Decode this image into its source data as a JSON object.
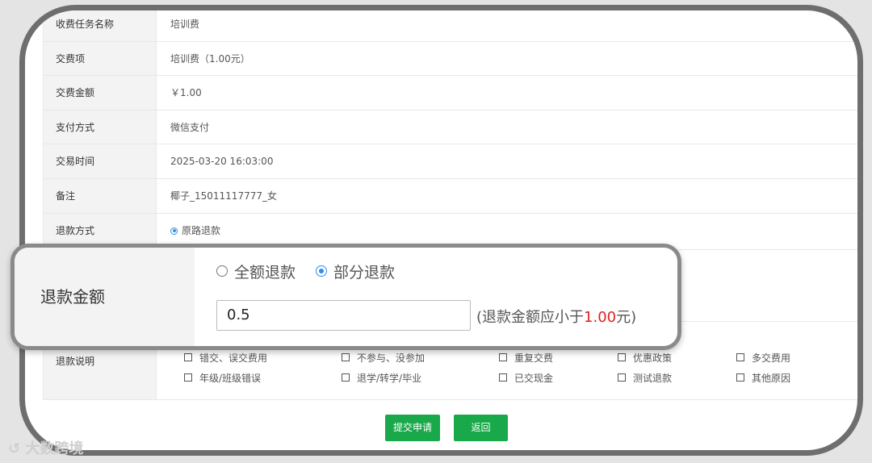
{
  "table": {
    "rows": [
      {
        "label": "收费任务名称",
        "value": "培训费"
      },
      {
        "label": "交费项",
        "value": "培训费（1.00元）"
      },
      {
        "label": "交费金额",
        "value": "￥1.00"
      },
      {
        "label": "支付方式",
        "value": "微信支付"
      },
      {
        "label": "交易时间",
        "value": "2025-03-20 16:03:00"
      },
      {
        "label": "备注",
        "value": "椰子_15011117777_女"
      },
      {
        "label": "退款方式",
        "value": "原路退款"
      }
    ],
    "reason_label": "退款说明",
    "reasons": [
      "错交、误交费用",
      "不参与、没参加",
      "重复交费",
      "优惠政策",
      "多交费用",
      "年级/班级错误",
      "退学/转学/毕业",
      "已交现金",
      "测试退款",
      "其他原因"
    ]
  },
  "refund_amount": {
    "label": "退款金额",
    "option_full": "全额退款",
    "option_partial": "部分退款",
    "selected": "部分退款",
    "input_value": "0.5",
    "hint_prefix": "(退款金额应小于",
    "hint_amount": "1.00",
    "hint_suffix": "元)"
  },
  "buttons": {
    "submit": "提交申请",
    "back": "返回"
  },
  "colors": {
    "accent": "#1aa94a",
    "radio": "#2d8cf0",
    "warning": "#e0201d"
  },
  "watermark": "大数跨境"
}
